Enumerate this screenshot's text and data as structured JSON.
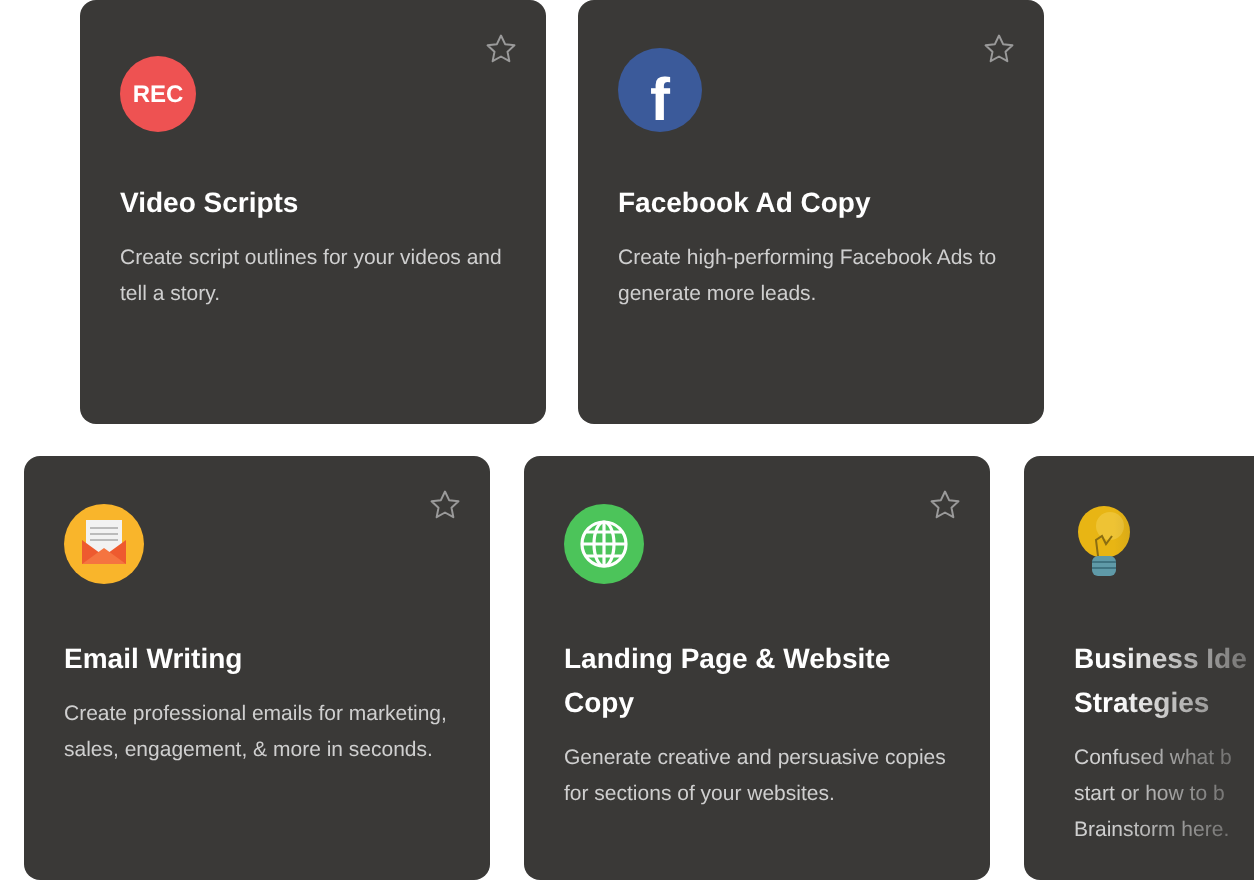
{
  "rows": [
    {
      "cards": [
        {
          "kind": "rec",
          "icon_label": "REC",
          "title": "Video Scripts",
          "description": "Create script outlines for your videos and tell a story."
        },
        {
          "kind": "facebook",
          "icon_label": "f",
          "title": "Facebook Ad Copy",
          "description": "Create high-performing Facebook Ads to generate more leads."
        }
      ]
    },
    {
      "cards": [
        {
          "kind": "email",
          "title": "Email Writing",
          "description": "Create professional emails for marketing, sales, engagement, & more in seconds."
        },
        {
          "kind": "globe",
          "title": "Landing Page & Website Copy",
          "description": "Generate creative and persuasive copies for sections of your websites."
        },
        {
          "kind": "bulb",
          "cut": true,
          "title": "Business Ide\nStrategies",
          "description": "Confused what b\nstart or how to b\nBrainstorm here."
        }
      ]
    }
  ]
}
